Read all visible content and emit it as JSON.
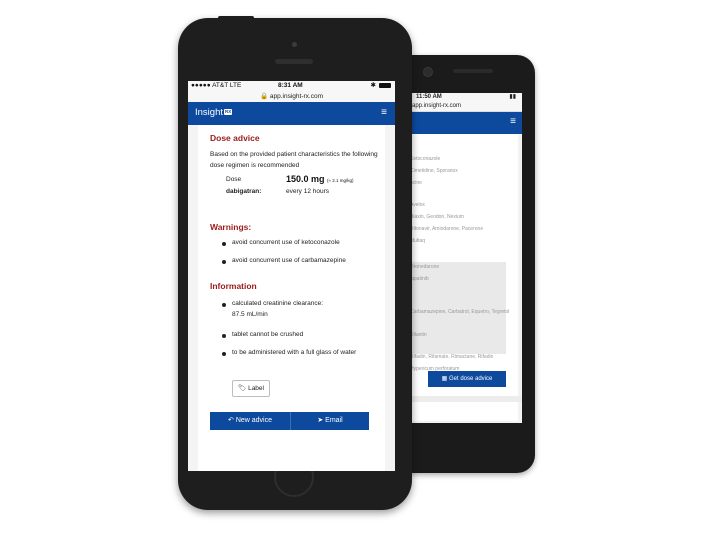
{
  "back_phone": {
    "status_time": "11:50 AM",
    "url": "app.insight-rx.com",
    "menu_icon": "hamburger-icon",
    "form_lines": [
      "Ketoconazole",
      "Cimetidine, Sporanox",
      "ocine",
      "Avelox",
      "Chloroquine, Cordarone, Norvir",
      "Biaxin, Geodon, Nexium",
      "Ritonavir, Amiodarone, Pacerone",
      "Amiodarone, Cordarone",
      "Multaq",
      "Dronedarone",
      "lapatinib",
      "Tykerb",
      "Carbamazepine, Carbatrol, Equetro, Tegretol",
      "Rifadin",
      "Dilantin",
      "Rifampin",
      "Rifadin, Rifamate, Rimactane, Rifadin",
      "Hypericum perforatum"
    ],
    "cta_label": "Get dose advice"
  },
  "front_phone": {
    "status": {
      "carrier": "●●●●● AT&T  LTE",
      "time": "8:31 AM",
      "right": "✱"
    },
    "url": "app.insight-rx.com",
    "brand": "Insight",
    "brand_badge": "RX",
    "menu_icon": "hamburger-icon",
    "dose_advice": {
      "heading": "Dose advice",
      "intro": "Based on the provided patient characteristics the following dose regimen is recommended",
      "dose_label": "Dose",
      "drug_label": "dabigatran:",
      "dose_value": "150.0 mg",
      "dose_unit": "(≈ 2.1 mg/kg)",
      "frequency": "every 12 hours"
    },
    "warnings": {
      "heading": "Warnings:",
      "items": [
        "avoid concurrent use of ketoconazole",
        "avoid concurrent use of carbamazepine"
      ]
    },
    "information": {
      "heading": "Information",
      "items": [
        "calculated creatinine clearance: 87.5 mL/min",
        "tablet cannot be crushed",
        "to be administered with a full glass of water"
      ]
    },
    "label_button": "Label",
    "new_advice_button": "New advice",
    "email_button": "Email"
  },
  "colors": {
    "brand_blue": "#0d4a9e",
    "heading_red": "#9b1b1b",
    "phone_body": "#1e1e1e"
  }
}
